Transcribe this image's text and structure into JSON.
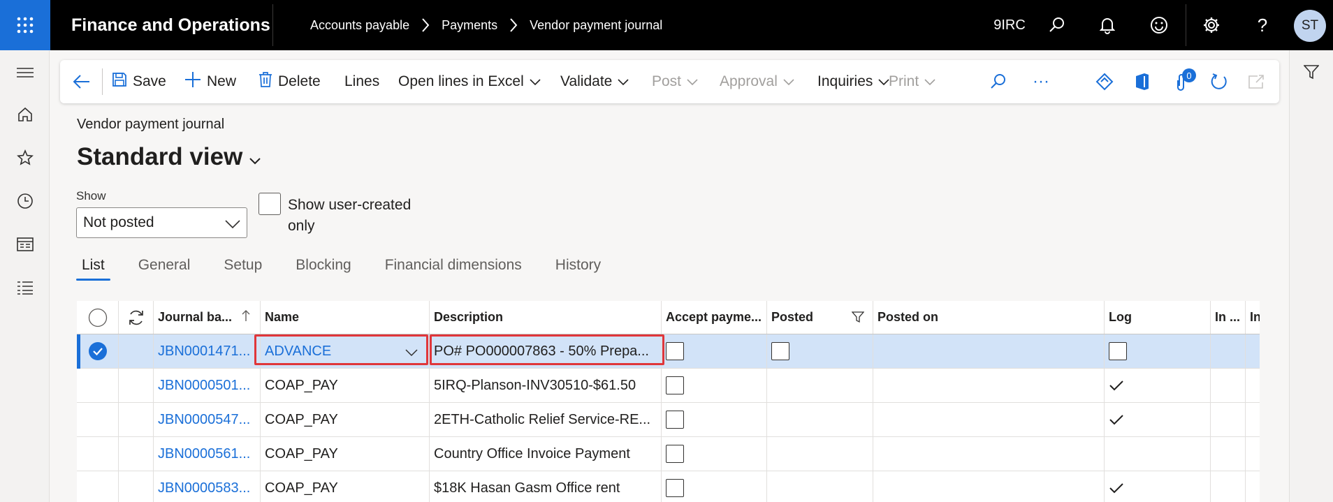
{
  "app": {
    "title": "Finance and Operations",
    "company": "9IRC",
    "user_initials": "ST"
  },
  "breadcrumbs": [
    "Accounts payable",
    "Payments",
    "Vendor payment journal"
  ],
  "toolbar": {
    "save": "Save",
    "new": "New",
    "delete": "Delete",
    "lines": "Lines",
    "open_lines_excel": "Open lines in Excel",
    "validate": "Validate",
    "post": "Post",
    "approval": "Approval",
    "inquiries": "Inquiries",
    "print": "Print",
    "more": "···",
    "attachments_count": "0"
  },
  "page": {
    "label": "Vendor payment journal",
    "view_name": "Standard view"
  },
  "filters": {
    "show_label": "Show",
    "show_value": "Not posted",
    "user_created_label": "Show user-created only"
  },
  "tabs": [
    "List",
    "General",
    "Setup",
    "Blocking",
    "Financial dimensions",
    "History"
  ],
  "grid": {
    "columns": [
      "Journal ba...",
      "Name",
      "Description",
      "Accept payme...",
      "Posted",
      "Posted on",
      "Log",
      "In ...",
      "In"
    ],
    "rows": [
      {
        "batch": "JBN0001471...",
        "name": "ADVANCE",
        "description": "PO# PO000007863 - 50% Prepa...",
        "log": false,
        "selected": true
      },
      {
        "batch": "JBN0000501...",
        "name": "COAP_PAY",
        "description": "5IRQ-Planson-INV30510-$61.50",
        "log": true,
        "selected": false
      },
      {
        "batch": "JBN0000547...",
        "name": "COAP_PAY",
        "description": "2ETH-Catholic Relief Service-RE...",
        "log": true,
        "selected": false
      },
      {
        "batch": "JBN0000561...",
        "name": "COAP_PAY",
        "description": "Country Office Invoice Payment",
        "log": false,
        "selected": false
      },
      {
        "batch": "JBN0000583...",
        "name": "COAP_PAY",
        "description": "$18K Hasan Gasm Office rent",
        "log": true,
        "selected": false
      }
    ]
  },
  "colors": {
    "accent": "#1a6fd8",
    "highlight": "#e0363a",
    "selected_row": "#d2e3f8"
  }
}
